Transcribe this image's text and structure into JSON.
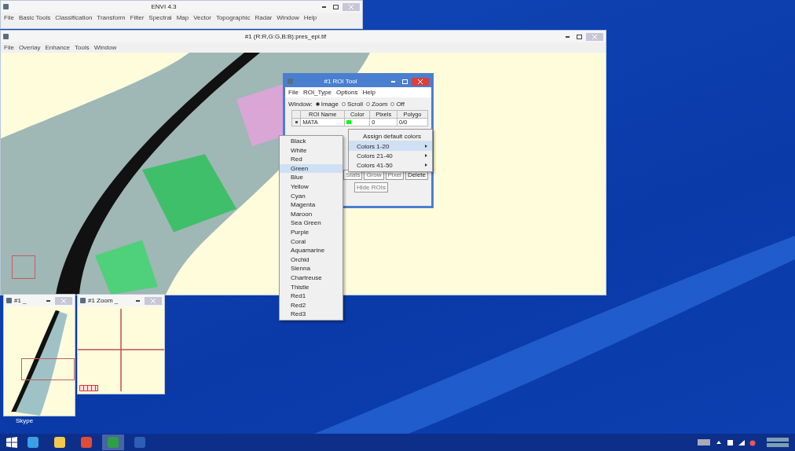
{
  "envi_window": {
    "title": "ENVI 4.3",
    "menu": [
      "File",
      "Basic Tools",
      "Classification",
      "Transform",
      "Filter",
      "Spectral",
      "Map",
      "Vector",
      "Topographic",
      "Radar",
      "Window",
      "Help"
    ]
  },
  "image_window": {
    "title": "#1 (R:R,G:G,B:B):pres_epi.tif",
    "menu": [
      "File",
      "Overlay",
      "Enhance",
      "Tools",
      "Window"
    ]
  },
  "roi_tool": {
    "title": "#1 ROI Tool",
    "menu": [
      "File",
      "ROI_Type",
      "Options",
      "Help"
    ],
    "window_label": "Window:",
    "window_options": [
      {
        "label": "Image",
        "selected": true
      },
      {
        "label": "Scroll",
        "selected": false
      },
      {
        "label": "Zoom",
        "selected": false
      },
      {
        "label": "Off",
        "selected": false
      }
    ],
    "columns": [
      "ROI Name",
      "Color",
      "Pixels",
      "Polygo"
    ],
    "rows": [
      {
        "name": "MATA",
        "color": "#00ff00",
        "pixels": "0",
        "polygons": "0/0"
      }
    ],
    "buttons": [
      "Stats",
      "Grow",
      "Pixel",
      "Delete"
    ],
    "bottom_button": "Hide ROIs"
  },
  "context_menu": [
    {
      "label": "Assign default colors",
      "submenu": false,
      "selected": false
    },
    {
      "label": "Colors 1-20",
      "submenu": true,
      "selected": true
    },
    {
      "label": "Colors 21-40",
      "submenu": true,
      "selected": false
    },
    {
      "label": "Colors 41-50",
      "submenu": true,
      "selected": false
    }
  ],
  "color_menu": [
    {
      "label": "Black",
      "selected": false
    },
    {
      "label": "White",
      "selected": false
    },
    {
      "label": "Red",
      "selected": false
    },
    {
      "label": "Green",
      "selected": true
    },
    {
      "label": "Blue",
      "selected": false
    },
    {
      "label": "Yellow",
      "selected": false
    },
    {
      "label": "Cyan",
      "selected": false
    },
    {
      "label": "Magenta",
      "selected": false
    },
    {
      "label": "Maroon",
      "selected": false
    },
    {
      "label": "Sea Green",
      "selected": false
    },
    {
      "label": "Purple",
      "selected": false
    },
    {
      "label": "Coral",
      "selected": false
    },
    {
      "label": "Aquamarine",
      "selected": false
    },
    {
      "label": "Orchid",
      "selected": false
    },
    {
      "label": "Sienna",
      "selected": false
    },
    {
      "label": "Chartreuse",
      "selected": false
    },
    {
      "label": "Thistle",
      "selected": false
    },
    {
      "label": "Red1",
      "selected": false
    },
    {
      "label": "Red2",
      "selected": false
    },
    {
      "label": "Red3",
      "selected": false
    }
  ],
  "scroll_window": {
    "title": "#1 _"
  },
  "zoom_window": {
    "title": "#1 Zoom _"
  },
  "desktop_icons": [
    {
      "label": "Skype"
    }
  ],
  "taskbar": {
    "apps": [
      {
        "kind": "ie",
        "active": false
      },
      {
        "kind": "folder",
        "active": false
      },
      {
        "kind": "chrome",
        "active": false
      },
      {
        "kind": "envi",
        "active": true
      },
      {
        "kind": "word",
        "active": false
      }
    ]
  }
}
